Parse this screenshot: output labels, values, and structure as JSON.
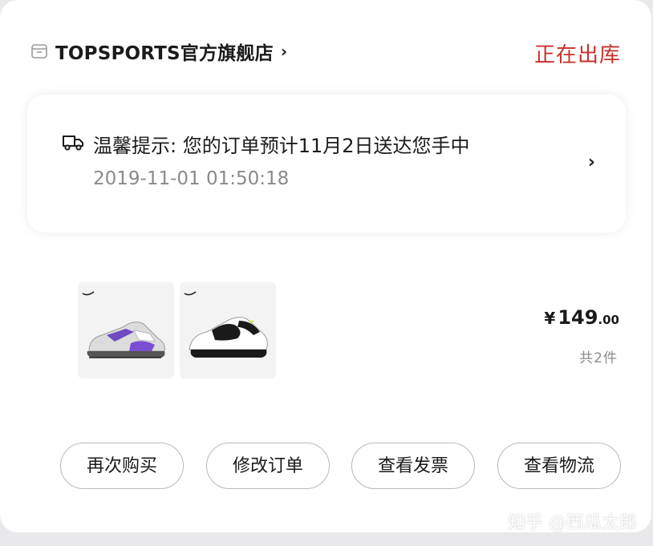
{
  "store": {
    "name": "TOPSPORTS官方旗舰店",
    "chevron": "›",
    "status": "正在出库"
  },
  "tip": {
    "message": "温馨提示: 您的订单预计11月2日送达您手中",
    "timestamp": "2019-11-01 01:50:18",
    "chevron": "›"
  },
  "order": {
    "currency": "¥",
    "price_int": "149",
    "price_dec": ".00",
    "quantity": "共2件",
    "products": [
      {
        "image": "shoe-purple-white"
      },
      {
        "image": "shoe-black-white"
      }
    ]
  },
  "actions": {
    "buy_again": "再次购买",
    "modify_order": "修改订单",
    "view_invoice": "查看发票",
    "view_logistics": "查看物流"
  },
  "watermark": "知乎 @西瓜太郎",
  "colors": {
    "status_red": "#c8302c",
    "text_dark": "#1b1b1b",
    "text_gray": "#8a8a8e"
  }
}
